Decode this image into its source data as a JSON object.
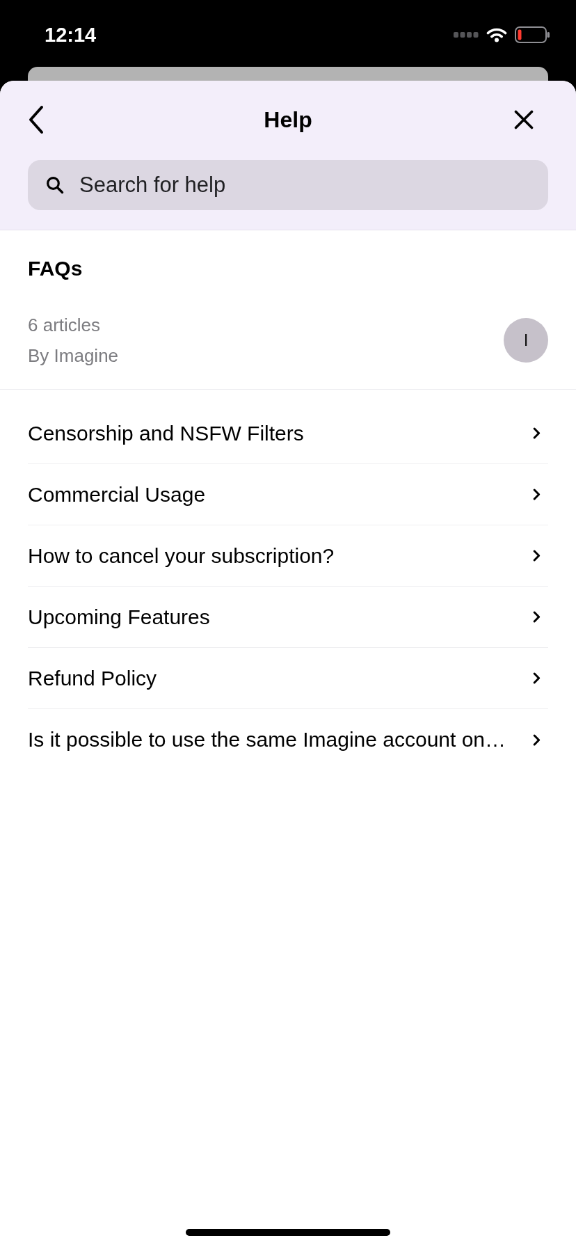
{
  "status_bar": {
    "time": "12:14"
  },
  "header": {
    "title": "Help"
  },
  "search": {
    "placeholder": "Search for help"
  },
  "collection": {
    "title": "FAQs",
    "article_count": "6 articles",
    "author": "By Imagine",
    "avatar_initial": "I"
  },
  "articles": [
    {
      "title": "Censorship and NSFW Filters"
    },
    {
      "title": "Commercial Usage"
    },
    {
      "title": "How to cancel your subscription?"
    },
    {
      "title": "Upcoming Features"
    },
    {
      "title": "Refund Policy"
    },
    {
      "title": "Is it possible to use the same Imagine account on…"
    }
  ]
}
